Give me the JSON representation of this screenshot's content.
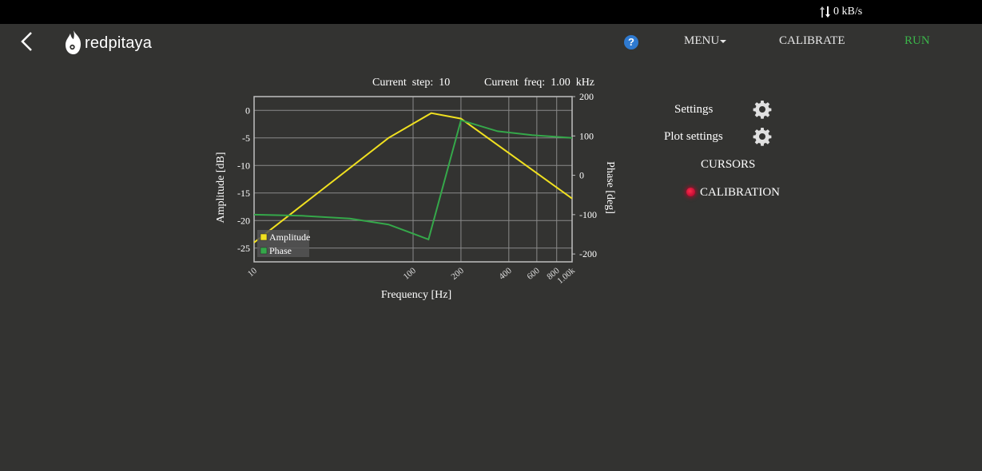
{
  "network": {
    "rate": "0 kB/s"
  },
  "nav": {
    "logo_text": "redpitaya",
    "help": "?",
    "menu": "MENU",
    "calibrate": "CALIBRATE",
    "run": "RUN"
  },
  "status": {
    "step_label": "Current  step:  10",
    "freq_label": "Current  freq:  1.00  kHz"
  },
  "sidebar": {
    "settings": "Settings",
    "plot_settings": "Plot settings",
    "cursors": "CURSORS",
    "calibration": "CALIBRATION"
  },
  "chart_data": {
    "type": "line",
    "xlabel": "Frequency   [Hz]",
    "ylabel_left": "Amplitude  [dB]",
    "ylabel_right": "Phase   [deg]",
    "x_scale": "log",
    "xlim": [
      10,
      1000
    ],
    "ylim_left": [
      -27.5,
      2.5
    ],
    "ylim_right": [
      -220,
      200
    ],
    "x_ticks": [
      {
        "value": 10,
        "label": "10"
      },
      {
        "value": 100,
        "label": "100"
      },
      {
        "value": 200,
        "label": "200"
      },
      {
        "value": 400,
        "label": "400"
      },
      {
        "value": 600,
        "label": "600"
      },
      {
        "value": 800,
        "label": "800"
      },
      {
        "value": 1000,
        "label": "1.00k"
      }
    ],
    "y_ticks_left": [
      0,
      -5,
      -10,
      -15,
      -20,
      -25
    ],
    "y_ticks_right": [
      200,
      100,
      0,
      -100,
      -200
    ],
    "legend_position": "bottom-left",
    "grid": true,
    "series": [
      {
        "name": "Amplitude",
        "axis": "left",
        "color": "#f0e020",
        "x": [
          10,
          70,
          130,
          200,
          1000
        ],
        "y": [
          -24.0,
          -5.0,
          -0.5,
          -1.5,
          -16.0
        ]
      },
      {
        "name": "Phase",
        "axis": "right",
        "color": "#35a84a",
        "x": [
          10,
          20,
          40,
          70,
          125,
          200,
          340,
          560,
          1000
        ],
        "y": [
          -100,
          -103,
          -110,
          -125,
          -163,
          140,
          112,
          102,
          95
        ]
      }
    ]
  }
}
